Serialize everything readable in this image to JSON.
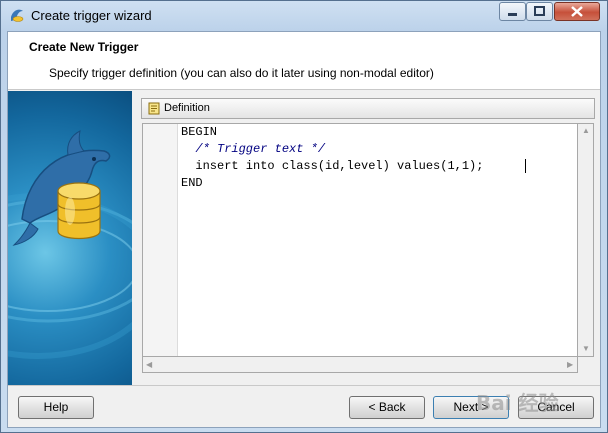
{
  "window": {
    "title": "Create trigger wizard"
  },
  "header": {
    "title": "Create New Trigger",
    "subtitle": "Specify trigger definition (you can also do it later using non-modal editor)"
  },
  "definition": {
    "tab_label": "Definition",
    "code_lines": [
      "BEGIN",
      "  /* Trigger text */",
      "  insert into class(id,level) values(1,1);",
      "END"
    ]
  },
  "buttons": {
    "help": "Help",
    "back": "< Back",
    "next": "Next >",
    "cancel": "Cancel"
  },
  "watermark": "Bai 经验",
  "colors": {
    "side_panel": "#1d7ab3",
    "comment": "#000080"
  },
  "icons": {
    "app": "app-dolphin-icon",
    "side": "dolphin-database-illustration",
    "definition": "definition-page-icon"
  }
}
